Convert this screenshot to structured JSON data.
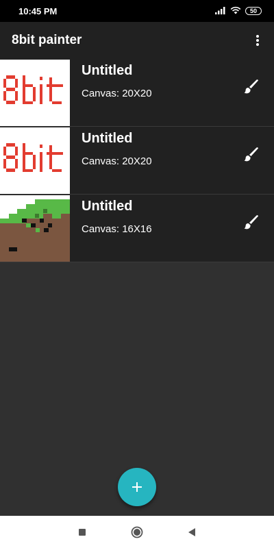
{
  "status_bar": {
    "time": "10:45 PM",
    "battery": "50",
    "icons": [
      "signal-icon",
      "wifi-icon",
      "battery-icon"
    ]
  },
  "app_bar": {
    "title": "8bit painter",
    "menu_icon": "overflow-menu-icon"
  },
  "drawings": [
    {
      "title": "Untitled",
      "canvas": "Canvas: 20X20",
      "thumbnail": "8bit-logo-thumbnail",
      "action_icon": "brush-icon"
    },
    {
      "title": "Untitled",
      "canvas": "Canvas: 20X20",
      "thumbnail": "8bit-logo-thumbnail",
      "action_icon": "brush-icon"
    },
    {
      "title": "Untitled",
      "canvas": "Canvas: 16X16",
      "thumbnail": "grass-block-thumbnail",
      "action_icon": "brush-icon"
    }
  ],
  "fab": {
    "icon": "plus-icon"
  },
  "nav_bar": {
    "icons": [
      "recents-square-icon",
      "home-circle-icon",
      "back-triangle-icon"
    ]
  },
  "colors": {
    "background": "#303030",
    "app_bar": "#212121",
    "accent": "#26b5c0",
    "thumbnail_red": "#e23c30",
    "grass_green": "#58b947",
    "dirt_brown": "#7b5640"
  }
}
